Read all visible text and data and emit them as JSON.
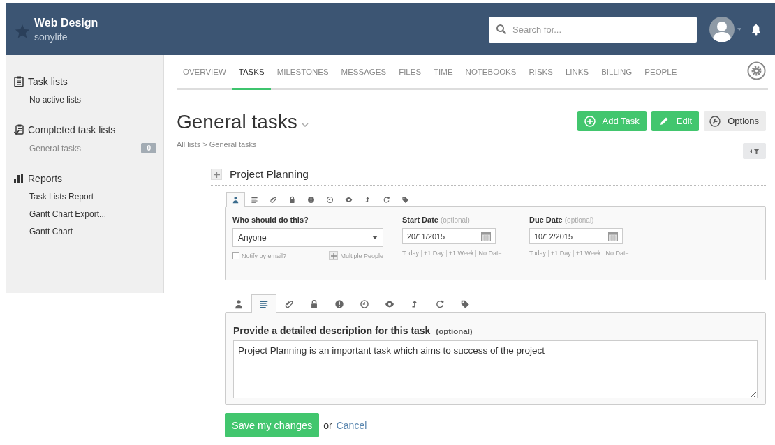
{
  "header": {
    "project": "Web Design",
    "company": "sonylife",
    "search": {
      "placeholder": "Search for..."
    }
  },
  "sidebar": {
    "sections": [
      {
        "kind": "lists",
        "title": "Task lists",
        "items": [
          {
            "label": "No active lists",
            "completed": false
          }
        ]
      },
      {
        "kind": "completed",
        "title": "Completed task lists",
        "items": [
          {
            "label": "General tasks",
            "completed": true,
            "count": "0"
          }
        ]
      },
      {
        "kind": "reports",
        "title": "Reports",
        "items": [
          {
            "label": "Task Lists Report",
            "completed": false
          },
          {
            "label": "Gantt Chart Export...",
            "completed": false
          },
          {
            "label": "Gantt Chart",
            "completed": false
          }
        ]
      }
    ]
  },
  "tabs": [
    {
      "label": "OVERVIEW",
      "selected": false
    },
    {
      "label": "TASKS",
      "selected": true
    },
    {
      "label": "MILESTONES",
      "selected": false
    },
    {
      "label": "MESSAGES",
      "selected": false
    },
    {
      "label": "FILES",
      "selected": false
    },
    {
      "label": "TIME",
      "selected": false
    },
    {
      "label": "NOTEBOOKS",
      "selected": false
    },
    {
      "label": "RISKS",
      "selected": false
    },
    {
      "label": "LINKS",
      "selected": false
    },
    {
      "label": "BILLING",
      "selected": false
    },
    {
      "label": "PEOPLE",
      "selected": false
    }
  ],
  "page": {
    "title": "General tasks",
    "breadcrumb": "All lists > General tasks",
    "actions": [
      {
        "kind": "add",
        "label": "Add Task"
      },
      {
        "kind": "edit",
        "label": "Edit"
      },
      {
        "kind": "options",
        "label": "Options"
      }
    ]
  },
  "task": {
    "name": "Project Planning",
    "panels": [
      {
        "kind": "assign",
        "tabs": [
          {
            "kind": "person",
            "selected": true
          },
          {
            "kind": "lines",
            "selected": false
          },
          {
            "kind": "clip",
            "selected": false
          },
          {
            "kind": "lock",
            "selected": false
          },
          {
            "kind": "alert",
            "selected": false
          },
          {
            "kind": "clock",
            "selected": false
          },
          {
            "kind": "eye",
            "selected": false
          },
          {
            "kind": "up",
            "selected": false
          },
          {
            "kind": "repeat",
            "selected": false
          },
          {
            "kind": "tag",
            "selected": false
          }
        ],
        "assignee": {
          "label": "Who should do this?",
          "value": "Anyone",
          "notify": {
            "label": "Notify by email?",
            "checked": false
          },
          "multiple": "Multiple People"
        },
        "dates": [
          {
            "label": "Start Date",
            "hint": "(optional)",
            "value": "20/11/2015",
            "shortcuts": [
              "Today",
              "+1 Day",
              "+1 Week",
              "No Date"
            ]
          },
          {
            "label": "Due Date",
            "hint": "(optional)",
            "value": "10/12/2015",
            "shortcuts": [
              "Today",
              "+1 Day",
              "+1 Week",
              "No Date"
            ]
          }
        ]
      },
      {
        "kind": "description",
        "tabs": [
          {
            "kind": "person",
            "selected": false
          },
          {
            "kind": "lines",
            "selected": true
          },
          {
            "kind": "clip",
            "selected": false
          },
          {
            "kind": "lock",
            "selected": false
          },
          {
            "kind": "alert",
            "selected": false
          },
          {
            "kind": "clock",
            "selected": false
          },
          {
            "kind": "eye",
            "selected": false
          },
          {
            "kind": "up",
            "selected": false
          },
          {
            "kind": "repeat",
            "selected": false
          },
          {
            "kind": "tag",
            "selected": false
          }
        ],
        "label": "Provide a detailed description for this task",
        "hint": "(optional)",
        "value": "Project Planning is an important task which aims to success of the project"
      }
    ]
  },
  "footer": {
    "save": "Save my changes",
    "or": "or",
    "cancel": "Cancel"
  }
}
